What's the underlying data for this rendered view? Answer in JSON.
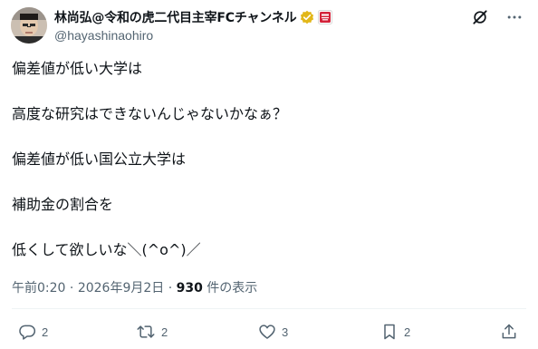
{
  "author": {
    "display_name": "林尚弘@令和の虎二代目主宰FCチャンネル",
    "handle": "@hayashinaohiro",
    "verified_icon": "verified-badge-icon",
    "affiliation_icon": "affiliation-badge-icon"
  },
  "header_icons": [
    "grok-icon",
    "more-icon"
  ],
  "tweet": {
    "lines": [
      "偏差値が低い大学は",
      "高度な研究はできないんじゃないかなぁ？",
      "偏差値が低い国公立大学は",
      "補助金の割合を",
      "低くして欲しいな＼(^o^)／"
    ]
  },
  "meta": {
    "time": "午前0:20",
    "sep1": " · ",
    "date": "2026年9月2日",
    "sep2": " · ",
    "views_count": "930",
    "views_label": " 件の表示"
  },
  "actions": {
    "reply_count": "2",
    "retweet_count": "2",
    "like_count": "3",
    "bookmark_count": "2"
  },
  "colors": {
    "text": "#0f1419",
    "secondary": "#536471",
    "verified": "#e2b719",
    "divider": "#eff3f4"
  }
}
